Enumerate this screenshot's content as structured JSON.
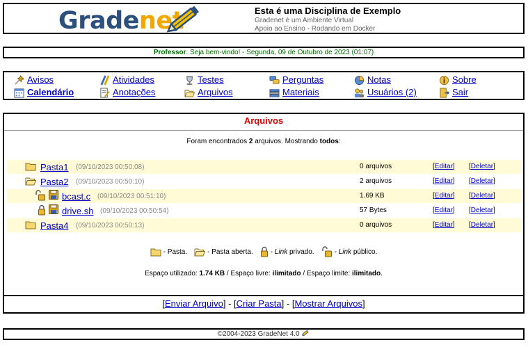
{
  "header": {
    "logo_grade": "Grade",
    "logo_net": "net",
    "course_title": "Esta é uma Disciplina de Exemplo",
    "course_sub1": "Gradenet é um Ambiente Virtual",
    "course_sub2": "Apoio ao Ensino - Rodando em Docker"
  },
  "welcome": {
    "role": "Professor",
    "message": ". Seja bem-vindo! - Segunda, 09 de Outubro de 2023 (01:07)"
  },
  "menu": {
    "items": [
      {
        "label": "Avisos",
        "icon": "pin-icon"
      },
      {
        "label": "Atividades",
        "icon": "pencils-icon"
      },
      {
        "label": "Testes",
        "icon": "trophy-icon"
      },
      {
        "label": "Perguntas",
        "icon": "speech-bubbles-icon"
      },
      {
        "label": "Notas",
        "icon": "pie-chart-icon"
      },
      {
        "label": "Sobre",
        "icon": "info-icon"
      },
      {
        "label": "Calendário",
        "icon": "calendar-icon"
      },
      {
        "label": "Anotações",
        "icon": "notepad-icon"
      },
      {
        "label": "Arquivos",
        "icon": "open-folder-icon"
      },
      {
        "label": "Materiais",
        "icon": "books-icon"
      },
      {
        "label": "Usuários (2)",
        "icon": "users-icon"
      },
      {
        "label": "Sair",
        "icon": "exit-door-icon"
      }
    ],
    "active": "Calendário"
  },
  "files": {
    "title": "Arquivos",
    "count_pre": "Foram encontrados ",
    "count_num": "2",
    "count_mid": " arquivos. Mostrando ",
    "count_mode": "todos",
    "count_post": ":",
    "edit_label": "Editar",
    "delete_label": "Deletar",
    "rows": [
      {
        "name": "Pasta1",
        "date": "(09/10/2023 00:50:08)",
        "size": "0 arquivos",
        "type": "folder"
      },
      {
        "name": "Pasta2",
        "date": "(09/10/2023 00:50:10)",
        "size": "2 arquivos",
        "type": "folder-open"
      },
      {
        "name": "bcast.c",
        "date": "(09/10/2023 00:51:10)",
        "size": "1.69 KB",
        "type": "file-public"
      },
      {
        "name": "drive.sh",
        "date": "(09/10/2023 00:50:54)",
        "size": "57 Bytes",
        "type": "file-private"
      },
      {
        "name": "Pasta4",
        "date": "(09/10/2023 00:50:13)",
        "size": "0 arquivos",
        "type": "folder"
      }
    ],
    "legend": {
      "folder": "- Pasta.",
      "folder_open": "- Pasta aberta.",
      "private_pre": "- ",
      "private_em": "Link",
      "private_post": " privado.",
      "public_pre": "- ",
      "public_em": "Link",
      "public_post": " público."
    },
    "space": {
      "used_label": "Espaço utilizado: ",
      "used_value": "1.74 KB",
      "free_label": " / Espaço livre: ",
      "free_value": "ilimitado",
      "limit_label": " / Espaço limite: ",
      "limit_value": "ilimitado",
      "end": "."
    },
    "actions": [
      "Enviar Arquivo",
      "Criar Pasta",
      "Mostrar Arquivos"
    ]
  },
  "footer": {
    "text": "©2004-2023 GradeNet 4.0"
  },
  "colors": {
    "title_red": "#e00000",
    "welcome_green": "#007000",
    "row_shade": "#fffbd6",
    "link_blue": "#0000cc"
  }
}
